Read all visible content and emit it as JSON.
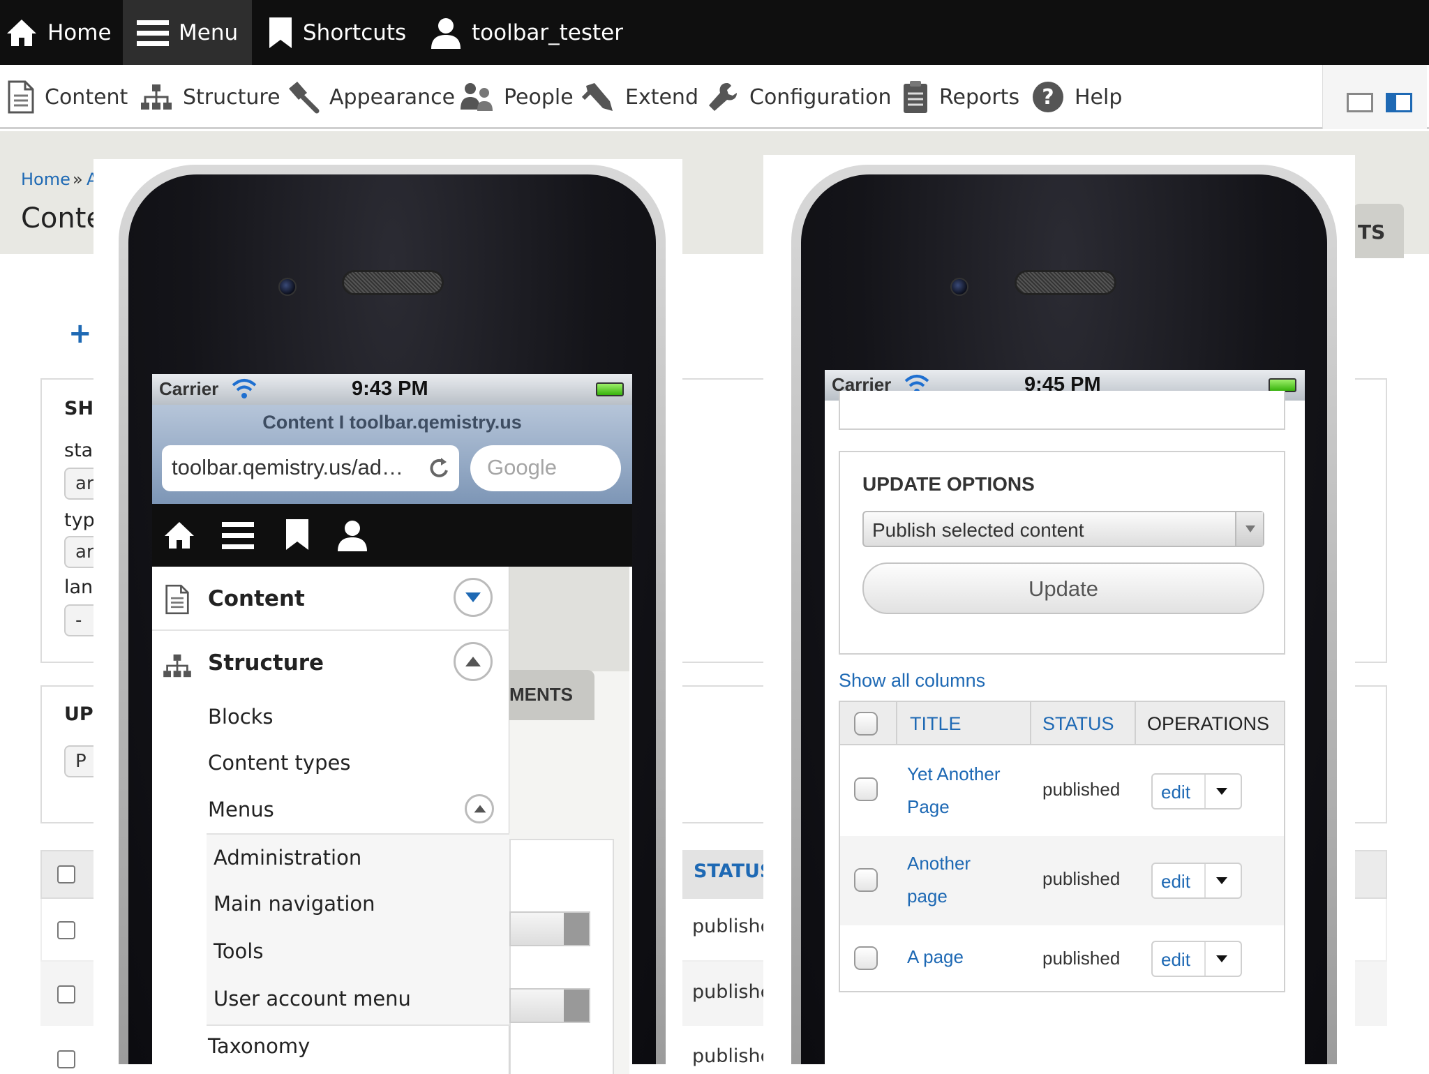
{
  "toolbar": {
    "home": "Home",
    "menu": "Menu",
    "shortcuts": "Shortcuts",
    "user": "toolbar_tester"
  },
  "admin_menu": {
    "content": "Content",
    "structure": "Structure",
    "appearance": "Appearance",
    "people": "People",
    "extend": "Extend",
    "configuration": "Configuration",
    "reports": "Reports",
    "help": "Help"
  },
  "background_page": {
    "breadcrumb_home": "Home",
    "breadcrumb_sep": "»",
    "breadcrumb_next": "A",
    "title": "Conte",
    "plus": "+",
    "filter_heading": "SH",
    "label_status": "sta",
    "value_status": "ar",
    "label_type": "typ",
    "value_type": "ar",
    "label_language": "lan",
    "value_language": "-",
    "update_heading": "UP",
    "update_select": "P",
    "tab_fragment": "TS",
    "table_status": "STATUS",
    "row_status_1": "publishe",
    "row_status_2": "publishe",
    "row_status_3": "publishe"
  },
  "left_phone": {
    "carrier": "Carrier",
    "time": "9:43 PM",
    "page_title": "Content I toolbar.qemistry.us",
    "url": "toolbar.qemistry.us/ad…",
    "search_placeholder": "Google",
    "tab_fragment": "MENTS",
    "tray": {
      "content": "Content",
      "structure": "Structure",
      "blocks": "Blocks",
      "content_types": "Content types",
      "menus": "Menus",
      "administration": "Administration",
      "main_navigation": "Main navigation",
      "tools": "Tools",
      "user_account_menu": "User account menu",
      "taxonomy": "Taxonomy"
    }
  },
  "right_phone": {
    "carrier": "Carrier",
    "time": "9:45 PM",
    "update_heading": "UPDATE OPTIONS",
    "select_value": "Publish selected content",
    "update_button": "Update",
    "show_all_columns": "Show all columns",
    "columns": {
      "title": "TITLE",
      "status": "STATUS",
      "operations": "OPERATIONS"
    },
    "rows": [
      {
        "title_line1": "Yet Another",
        "title_line2": "Page",
        "status": "published",
        "op": "edit"
      },
      {
        "title_line1": "Another",
        "title_line2": "page",
        "status": "published",
        "op": "edit"
      },
      {
        "title_line1": "A page",
        "title_line2": "",
        "status": "published",
        "op": "edit"
      }
    ]
  },
  "colors": {
    "toolbar_bg": "#0f0f0f",
    "link_blue": "#1e69b4",
    "page_bg": "#e8e8e3"
  }
}
